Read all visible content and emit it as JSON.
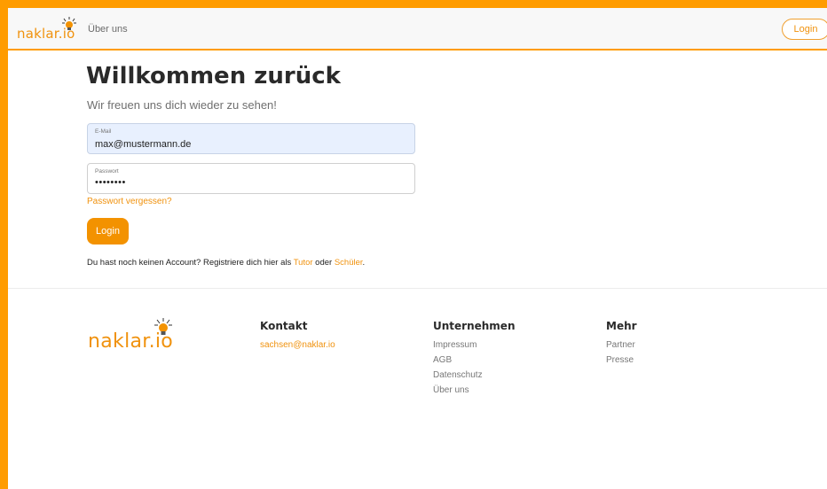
{
  "header": {
    "logo_text": "naklar.io",
    "nav_about": "Über uns",
    "login_label": "Login"
  },
  "main": {
    "title": "Willkommen zurück",
    "subtitle": "Wir freuen uns dich wieder zu sehen!",
    "email": {
      "label": "E-Mail",
      "value": "max@mustermann.de"
    },
    "password": {
      "label": "Passwort",
      "value": "••••••••"
    },
    "forgot_label": "Passwort vergessen?",
    "login_button": "Login",
    "register": {
      "prefix": "Du hast noch keinen Account? Registriere dich hier als ",
      "tutor": "Tutor",
      "middle": " oder ",
      "student": "Schüler",
      "suffix": "."
    }
  },
  "footer": {
    "logo_text": "naklar.io",
    "kontakt": {
      "heading": "Kontakt",
      "email": "sachsen@naklar.io"
    },
    "unternehmen": {
      "heading": "Unternehmen",
      "items": [
        "Impressum",
        "AGB",
        "Datenschutz",
        "Über uns"
      ]
    },
    "mehr": {
      "heading": "Mehr",
      "items": [
        "Partner",
        "Presse"
      ]
    }
  },
  "colors": {
    "accent": "#f39200",
    "frame": "#ff9c00",
    "field_autofill": "#e8f0fe"
  },
  "icons": {
    "logo": "lightbulb-icon"
  }
}
